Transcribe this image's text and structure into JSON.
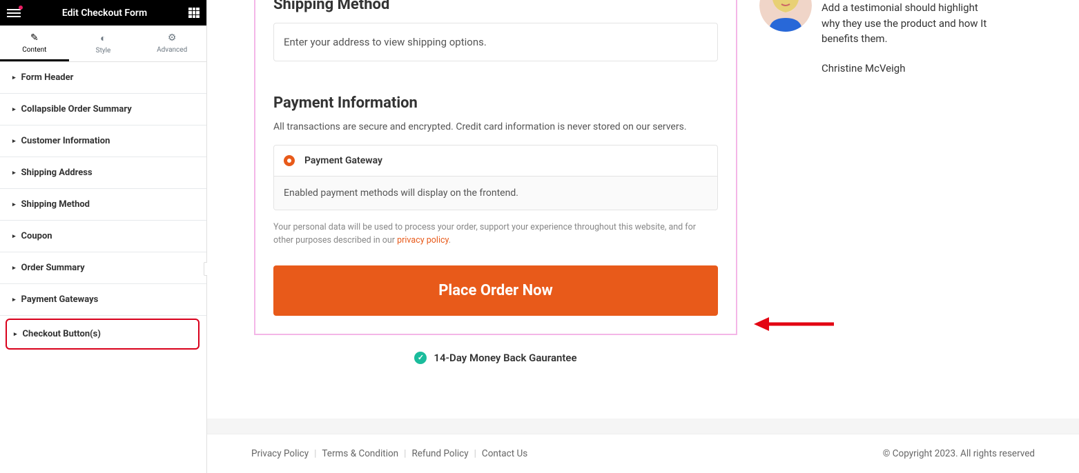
{
  "header": {
    "title": "Edit Checkout Form"
  },
  "tabs": {
    "content": "Content",
    "style": "Style",
    "advanced": "Advanced"
  },
  "accordion": {
    "formHeader": "Form Header",
    "collapsibleOrderSummary": "Collapsible Order Summary",
    "customerInformation": "Customer Information",
    "shippingAddress": "Shipping Address",
    "shippingMethod": "Shipping Method",
    "coupon": "Coupon",
    "orderSummary": "Order Summary",
    "paymentGateways": "Payment Gateways",
    "checkoutButtons": "Checkout Button(s)"
  },
  "form": {
    "shipping": {
      "title": "Shipping Method",
      "placeholder": "Enter your address to view shipping options."
    },
    "payment": {
      "title": "Payment Information",
      "desc": "All transactions are secure and encrypted. Credit card information is never stored on our servers.",
      "gateway": "Payment Gateway",
      "enabledInfo": "Enabled payment methods will display on the frontend.",
      "privacy1": "Your personal data will be used to process your order, support your experience throughout this website, and for other purposes described in our ",
      "privacyLink": "privacy policy",
      "placeOrder": "Place Order Now"
    },
    "guarantee": "14-Day Money Back Gaurantee"
  },
  "testimonial": {
    "text": "Add a testimonial should highlight why they use the product and how It benefits them.",
    "name": "Christine McVeigh"
  },
  "footer": {
    "privacy": "Privacy Policy",
    "terms": "Terms & Condition",
    "refund": "Refund Policy",
    "contact": "Contact Us",
    "copyright": "© Copyright 2023. All rights reserved"
  }
}
